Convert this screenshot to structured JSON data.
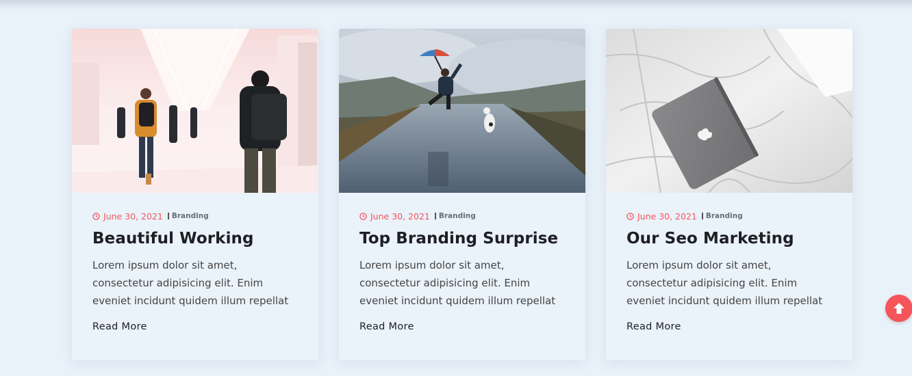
{
  "accent_color": "#f5545a",
  "posts": [
    {
      "image_alt": "people walking in bright corridor",
      "date": "June 30, 2021",
      "category": "Branding",
      "title": "Beautiful Working",
      "excerpt": "Lorem ipsum dolor sit amet, consectetur adipisicing elit. Enim eveniet incidunt quidem illum repellat",
      "link": "Read More"
    },
    {
      "image_alt": "person jumping with umbrella on wet road",
      "date": "June 30, 2021",
      "category": "Branding",
      "title": "Top Branding Surprise",
      "excerpt": "Lorem ipsum dolor sit amet, consectetur adipisicing elit. Enim eveniet incidunt quidem illum repellat",
      "link": "Read More"
    },
    {
      "image_alt": "laptop on white bed sheets",
      "date": "June 30, 2021",
      "category": "Branding",
      "title": "Our Seo Marketing",
      "excerpt": "Lorem ipsum dolor sit amet, consectetur adipisicing elit. Enim eveniet incidunt quidem illum repellat",
      "link": "Read More"
    }
  ],
  "scroll_top_icon": "arrow-up-icon"
}
